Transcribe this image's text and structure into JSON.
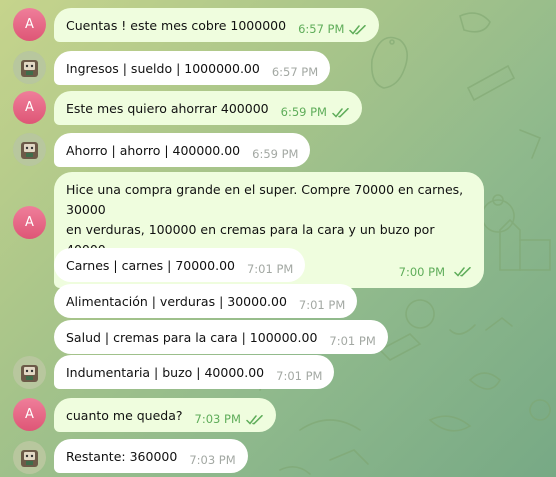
{
  "colors": {
    "outgoing_bubble": "#effdde",
    "incoming_bubble": "#ffffff",
    "outgoing_time": "#5fad5a",
    "incoming_time": "#a3a8a3",
    "user_avatar": "#e56b86"
  },
  "user_avatar_initial": "A",
  "messages": [
    {
      "sender": "user",
      "text": "Cuentas ! este mes cobre 1000000",
      "time": "6:57 PM",
      "read": true
    },
    {
      "sender": "bot",
      "text": "Ingresos | sueldo | 1000000.00",
      "time": "6:57 PM"
    },
    {
      "sender": "user",
      "text": "Este mes quiero ahorrar 400000",
      "time": "6:59 PM",
      "read": true
    },
    {
      "sender": "bot",
      "text": "Ahorro | ahorro | 400000.00",
      "time": "6:59 PM"
    },
    {
      "sender": "user",
      "text_line1": "Hice una compra grande en el super. Compre 70000 en carnes, 30000",
      "text_line2": "en verduras, 100000 en cremas para la cara y un buzo por 40000",
      "time": "7:00 PM",
      "read": true
    },
    {
      "sender": "bot",
      "text": "Carnes | carnes | 70000.00",
      "time": "7:01 PM"
    },
    {
      "sender": "bot",
      "text": "Alimentación | verduras | 30000.00",
      "time": "7:01 PM"
    },
    {
      "sender": "bot",
      "text": "Salud | cremas para la cara | 100000.00",
      "time": "7:01 PM"
    },
    {
      "sender": "bot",
      "text": "Indumentaria | buzo | 40000.00",
      "time": "7:01 PM"
    },
    {
      "sender": "user",
      "text": "cuanto me queda?",
      "time": "7:03 PM",
      "read": true
    },
    {
      "sender": "bot",
      "text": "Restante:  360000",
      "time": "7:03 PM"
    }
  ]
}
